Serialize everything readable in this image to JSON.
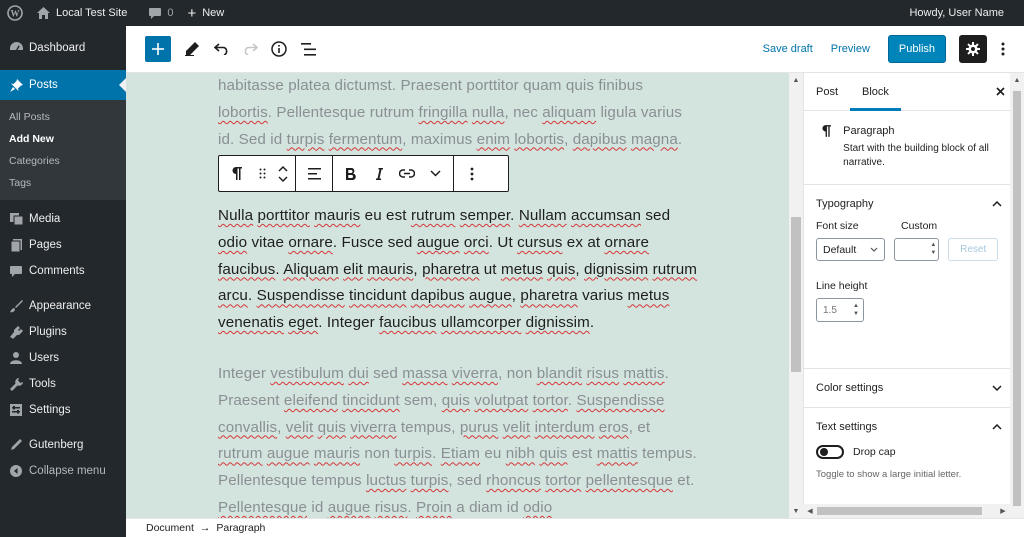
{
  "admin_bar": {
    "site_name": "Local Test Site",
    "comments_count": "0",
    "new_label": "New",
    "greeting": "Howdy, User Name"
  },
  "sidebar": {
    "items": [
      {
        "label": "Dashboard",
        "icon": "dashboard-icon"
      },
      {
        "label": "Posts",
        "icon": "pin-icon"
      },
      {
        "label": "Media",
        "icon": "media-icon"
      },
      {
        "label": "Pages",
        "icon": "pages-icon"
      },
      {
        "label": "Comments",
        "icon": "comments-icon"
      },
      {
        "label": "Appearance",
        "icon": "appearance-icon"
      },
      {
        "label": "Plugins",
        "icon": "plugins-icon"
      },
      {
        "label": "Users",
        "icon": "users-icon"
      },
      {
        "label": "Tools",
        "icon": "tools-icon"
      },
      {
        "label": "Settings",
        "icon": "settings-icon"
      },
      {
        "label": "Gutenberg",
        "icon": "gutenberg-icon"
      },
      {
        "label": "Collapse menu",
        "icon": "collapse-icon"
      }
    ],
    "submenu": [
      "All Posts",
      "Add New",
      "Categories",
      "Tags"
    ]
  },
  "header": {
    "save_draft": "Save draft",
    "preview": "Preview",
    "publish": "Publish"
  },
  "content": {
    "para1": [
      {
        "t": "habitasse platea dictumst. Praesent porttitor quam quis finibus "
      },
      {
        "t": "lobortis",
        "s": true
      },
      {
        "t": ". Pellentesque rutrum "
      },
      {
        "t": "fringilla",
        "s": true
      },
      {
        "t": " "
      },
      {
        "t": "nulla",
        "s": true
      },
      {
        "t": ", nec "
      },
      {
        "t": "aliquam",
        "s": true
      },
      {
        "t": " ligula varius id. Sed id "
      },
      {
        "t": "turpis",
        "s": true
      },
      {
        "t": " "
      },
      {
        "t": "fermentum",
        "s": true
      },
      {
        "t": ", maximus "
      },
      {
        "t": "enim",
        "s": true
      },
      {
        "t": " "
      },
      {
        "t": "lobortis",
        "s": true
      },
      {
        "t": ", "
      },
      {
        "t": "dapibus",
        "s": true
      },
      {
        "t": " "
      },
      {
        "t": "magna",
        "s": true
      },
      {
        "t": "."
      }
    ],
    "para2": [
      {
        "t": "Nulla",
        "s": true
      },
      {
        "t": " "
      },
      {
        "t": "porttitor",
        "s": true
      },
      {
        "t": " "
      },
      {
        "t": "mauris",
        "s": true
      },
      {
        "t": " eu est "
      },
      {
        "t": "rutrum",
        "s": true
      },
      {
        "t": " "
      },
      {
        "t": "semper",
        "s": true
      },
      {
        "t": ". "
      },
      {
        "t": "Nullam",
        "s": true
      },
      {
        "t": " "
      },
      {
        "t": "accumsan",
        "s": true
      },
      {
        "t": " sed "
      },
      {
        "t": "odio",
        "s": true
      },
      {
        "t": " vitae "
      },
      {
        "t": "ornare",
        "s": true
      },
      {
        "t": ". Fusce sed "
      },
      {
        "t": "augue",
        "s": true
      },
      {
        "t": " "
      },
      {
        "t": "orci",
        "s": true
      },
      {
        "t": ". Ut "
      },
      {
        "t": "cursus",
        "s": true
      },
      {
        "t": " ex at "
      },
      {
        "t": "ornare",
        "s": true
      },
      {
        "t": " "
      },
      {
        "t": "faucibus",
        "s": true
      },
      {
        "t": ". "
      },
      {
        "t": "Aliquam",
        "s": true
      },
      {
        "t": " "
      },
      {
        "t": "elit",
        "s": true
      },
      {
        "t": " "
      },
      {
        "t": "mauris",
        "s": true
      },
      {
        "t": ", "
      },
      {
        "t": "pharetra",
        "s": true
      },
      {
        "t": " ut "
      },
      {
        "t": "metus",
        "s": true
      },
      {
        "t": " "
      },
      {
        "t": "quis",
        "s": true
      },
      {
        "t": ", "
      },
      {
        "t": "dignissim",
        "s": true
      },
      {
        "t": " "
      },
      {
        "t": "rutrum",
        "s": true
      },
      {
        "t": " "
      },
      {
        "t": "arcu",
        "s": true
      },
      {
        "t": ". "
      },
      {
        "t": "Suspendisse",
        "s": true
      },
      {
        "t": " "
      },
      {
        "t": "tincidunt",
        "s": true
      },
      {
        "t": " "
      },
      {
        "t": "dapibus",
        "s": true
      },
      {
        "t": " "
      },
      {
        "t": "augue",
        "s": true
      },
      {
        "t": ", "
      },
      {
        "t": "pharetra",
        "s": true
      },
      {
        "t": " varius "
      },
      {
        "t": "metus",
        "s": true
      },
      {
        "t": " "
      },
      {
        "t": "venenatis",
        "s": true
      },
      {
        "t": " "
      },
      {
        "t": "eget",
        "s": true
      },
      {
        "t": ". Integer "
      },
      {
        "t": "faucibus",
        "s": true
      },
      {
        "t": " "
      },
      {
        "t": "ullamcorper",
        "s": true
      },
      {
        "t": " "
      },
      {
        "t": "dignissim",
        "s": true
      },
      {
        "t": "."
      }
    ],
    "para3": [
      {
        "t": "Integer "
      },
      {
        "t": "vestibulum",
        "s": true
      },
      {
        "t": " "
      },
      {
        "t": "dui",
        "s": true
      },
      {
        "t": " sed "
      },
      {
        "t": "massa",
        "s": true
      },
      {
        "t": " "
      },
      {
        "t": "viverra",
        "s": true
      },
      {
        "t": ", non "
      },
      {
        "t": "blandit",
        "s": true
      },
      {
        "t": " "
      },
      {
        "t": "risus",
        "s": true
      },
      {
        "t": " "
      },
      {
        "t": "mattis",
        "s": true
      },
      {
        "t": ". Praesent "
      },
      {
        "t": "eleifend",
        "s": true
      },
      {
        "t": " "
      },
      {
        "t": "tincidunt",
        "s": true
      },
      {
        "t": " sem, "
      },
      {
        "t": "quis",
        "s": true
      },
      {
        "t": " "
      },
      {
        "t": "volutpat",
        "s": true
      },
      {
        "t": " "
      },
      {
        "t": "tortor",
        "s": true
      },
      {
        "t": ". "
      },
      {
        "t": "Suspendisse",
        "s": true
      },
      {
        "t": " "
      },
      {
        "t": "convallis",
        "s": true
      },
      {
        "t": ", "
      },
      {
        "t": "velit",
        "s": true
      },
      {
        "t": " "
      },
      {
        "t": "quis",
        "s": true
      },
      {
        "t": " "
      },
      {
        "t": "viverra",
        "s": true
      },
      {
        "t": " tempus, "
      },
      {
        "t": "purus",
        "s": true
      },
      {
        "t": " "
      },
      {
        "t": "velit",
        "s": true
      },
      {
        "t": " "
      },
      {
        "t": "interdum",
        "s": true
      },
      {
        "t": " "
      },
      {
        "t": "eros",
        "s": true
      },
      {
        "t": ", et "
      },
      {
        "t": "rutrum",
        "s": true
      },
      {
        "t": " "
      },
      {
        "t": "augue",
        "s": true
      },
      {
        "t": " "
      },
      {
        "t": "mauris",
        "s": true
      },
      {
        "t": " non "
      },
      {
        "t": "turpis",
        "s": true
      },
      {
        "t": ". "
      },
      {
        "t": "Etiam",
        "s": true
      },
      {
        "t": " eu "
      },
      {
        "t": "nibh",
        "s": true
      },
      {
        "t": " "
      },
      {
        "t": "quis",
        "s": true
      },
      {
        "t": " est "
      },
      {
        "t": "mattis",
        "s": true
      },
      {
        "t": " tempus. Pellentesque tempus "
      },
      {
        "t": "luctus",
        "s": true
      },
      {
        "t": " "
      },
      {
        "t": "turpis",
        "s": true
      },
      {
        "t": ", sed "
      },
      {
        "t": "rhoncus",
        "s": true
      },
      {
        "t": " "
      },
      {
        "t": "tortor",
        "s": true
      },
      {
        "t": " "
      },
      {
        "t": "pellentesque",
        "s": true
      },
      {
        "t": " et. "
      },
      {
        "t": "Pellentesque",
        "s": true
      },
      {
        "t": " id "
      },
      {
        "t": "augue",
        "s": true
      },
      {
        "t": " "
      },
      {
        "t": "risus",
        "s": true
      },
      {
        "t": ". "
      },
      {
        "t": "Proin",
        "s": true
      },
      {
        "t": " a diam id "
      },
      {
        "t": "odio",
        "s": true
      }
    ]
  },
  "settings_sidebar": {
    "tab_post": "Post",
    "tab_block": "Block",
    "block_title": "Paragraph",
    "block_desc": "Start with the building block of all narrative.",
    "typography": "Typography",
    "font_size_label": "Font size",
    "custom_label": "Custom",
    "font_size_value": "Default",
    "reset": "Reset",
    "line_height_label": "Line height",
    "line_height_value": "1.5",
    "color_settings": "Color settings",
    "text_settings": "Text settings",
    "drop_cap": "Drop cap",
    "drop_cap_help": "Toggle to show a large initial letter."
  },
  "footer": {
    "breadcrumb": [
      "Document",
      "Paragraph"
    ],
    "separator": "→"
  }
}
